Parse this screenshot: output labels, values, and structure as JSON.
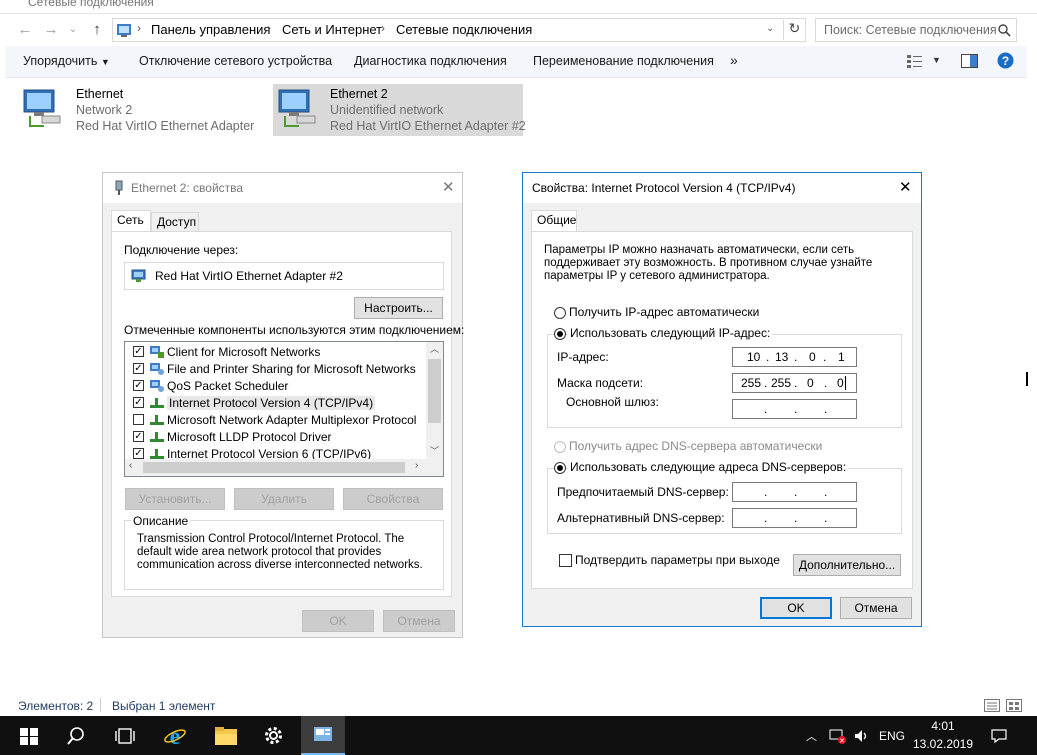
{
  "window": {
    "title": "Сетевые подключения"
  },
  "address": {
    "crumbs": [
      "Панель управления",
      "Сеть и Интернет",
      "Сетевые подключения"
    ],
    "search_placeholder": "Поиск: Сетевые подключения"
  },
  "commands": {
    "organize": "Упорядочить",
    "disable": "Отключение сетевого устройства",
    "diagnose": "Диагностика подключения",
    "rename": "Переименование подключения",
    "more": "»"
  },
  "adapters": [
    {
      "name": "Ethernet",
      "network": "Network  2",
      "device": "Red Hat VirtIO Ethernet Adapter"
    },
    {
      "name": "Ethernet 2",
      "network": "Unidentified network",
      "device": "Red Hat VirtIO Ethernet Adapter #2"
    }
  ],
  "props_dialog": {
    "title": "Ethernet 2: свойства",
    "tabs": [
      "Сеть",
      "Доступ"
    ],
    "connect_via_label": "Подключение через:",
    "adapter_name": "Red Hat VirtIO Ethernet Adapter #2",
    "configure_btn": "Настроить...",
    "components_label": "Отмеченные компоненты используются этим подключением:",
    "components": [
      {
        "label": "Client for Microsoft Networks",
        "checked": true,
        "icon": "network-client-icon"
      },
      {
        "label": "File and Printer Sharing for Microsoft Networks",
        "checked": true,
        "icon": "network-service-icon"
      },
      {
        "label": "QoS Packet Scheduler",
        "checked": true,
        "icon": "network-service-icon"
      },
      {
        "label": "Internet Protocol Version 4 (TCP/IPv4)",
        "checked": true,
        "icon": "protocol-icon"
      },
      {
        "label": "Microsoft Network Adapter Multiplexor Protocol",
        "checked": false,
        "icon": "protocol-icon"
      },
      {
        "label": "Microsoft LLDP Protocol Driver",
        "checked": true,
        "icon": "protocol-icon"
      },
      {
        "label": "Internet Protocol Version 6 (TCP/IPv6)",
        "checked": true,
        "icon": "protocol-icon"
      }
    ],
    "install_btn": "Установить...",
    "remove_btn": "Удалить",
    "properties_btn": "Свойства",
    "description_label": "Описание",
    "description": "Transmission Control Protocol/Internet Protocol. The default wide area network protocol that provides communication across diverse interconnected networks.",
    "ok": "OK",
    "cancel": "Отмена"
  },
  "ipv4_dialog": {
    "title": "Свойства: Internet Protocol Version 4 (TCP/IPv4)",
    "tab": "Общие",
    "intro": "Параметры IP можно назначать автоматически, если сеть поддерживает эту возможность. В противном случае узнайте параметры IP у сетевого администратора.",
    "auto_ip": "Получить IP-адрес автоматически",
    "manual_ip": "Использовать следующий IP-адрес:",
    "ip_label": "IP-адрес:",
    "ip_value": [
      "10",
      "13",
      "0",
      "1"
    ],
    "mask_label": "Маска подсети:",
    "mask_value": [
      "255",
      "255",
      "0",
      "0"
    ],
    "gateway_label": "Основной шлюз:",
    "auto_dns": "Получить адрес DNS-сервера автоматически",
    "manual_dns": "Использовать следующие адреса DNS-серверов:",
    "preferred_dns_label": "Предпочитаемый DNS-сервер:",
    "alternate_dns_label": "Альтернативный DNS-сервер:",
    "validate_label": "Подтвердить параметры при выходе",
    "advanced_btn": "Дополнительно...",
    "ok": "OK",
    "cancel": "Отмена"
  },
  "status": {
    "items": "Элементов: 2",
    "selected": "Выбран 1 элемент"
  },
  "tray": {
    "lang": "ENG",
    "time": "4:01",
    "date": "13.02.2019"
  },
  "colors": {
    "accent": "#0078d7",
    "taskbar": "#101010",
    "selected_item": "#d9d9d9"
  }
}
